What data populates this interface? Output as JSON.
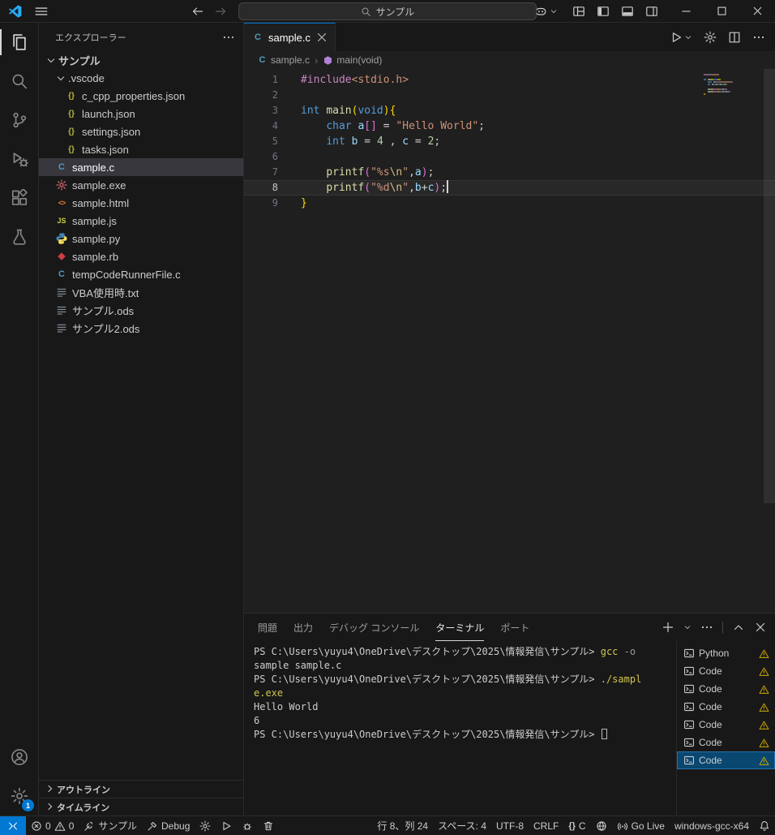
{
  "titlebar": {
    "command_center_text": "サンプル",
    "left_icons": [
      {
        "icon": "vscode-logo",
        "name": "vscode-logo",
        "clickable": false
      },
      {
        "icon": "menu",
        "name": "menu-button",
        "clickable": true
      }
    ],
    "nav": [
      {
        "icon": "arrow-left",
        "name": "back-button",
        "enabled": true
      },
      {
        "icon": "arrow-right",
        "name": "forward-button",
        "enabled": false
      }
    ],
    "right_controls": [
      {
        "icon": "copilot",
        "name": "copilot-menu",
        "chevron": true
      },
      {
        "icon": "layout-grid",
        "name": "customize-layout-button"
      },
      {
        "icon": "layout-sidebar-left",
        "name": "toggle-primary-sidebar-button"
      },
      {
        "icon": "layout-panel",
        "name": "toggle-panel-button"
      },
      {
        "icon": "layout-sidebar-right",
        "name": "toggle-secondary-sidebar-button"
      }
    ],
    "window_controls": [
      {
        "icon": "minimize",
        "name": "minimize-button"
      },
      {
        "icon": "maximize",
        "name": "maximize-button"
      },
      {
        "icon": "close",
        "name": "close-button"
      }
    ]
  },
  "activity_bar": {
    "items": [
      {
        "icon": "files",
        "name": "explorer",
        "active": true
      },
      {
        "icon": "search",
        "name": "search"
      },
      {
        "icon": "source-control",
        "name": "source-control"
      },
      {
        "icon": "debug",
        "name": "run-and-debug"
      },
      {
        "icon": "extensions",
        "name": "extensions"
      },
      {
        "icon": "beaker",
        "name": "testing"
      }
    ],
    "bottom": [
      {
        "icon": "account",
        "name": "accounts"
      },
      {
        "icon": "gear",
        "name": "manage",
        "badge": "1"
      }
    ]
  },
  "explorer": {
    "title": "エクスプローラー",
    "tree": [
      {
        "label": "サンプル",
        "level": 0,
        "chevron": "down",
        "bold": true
      },
      {
        "label": ".vscode",
        "level": 1,
        "chevron": "down"
      },
      {
        "label": "c_cpp_properties.json",
        "icon": "json",
        "level": 2
      },
      {
        "label": "launch.json",
        "icon": "json",
        "level": 2
      },
      {
        "label": "settings.json",
        "icon": "json",
        "level": 2
      },
      {
        "label": "tasks.json",
        "icon": "json",
        "level": 2
      },
      {
        "label": "sample.c",
        "icon": "c-file",
        "level": 1,
        "selected": true
      },
      {
        "label": "sample.exe",
        "icon": "exe-file",
        "level": 1
      },
      {
        "label": "sample.html",
        "icon": "html-file",
        "level": 1
      },
      {
        "label": "sample.js",
        "icon": "js-file",
        "level": 1
      },
      {
        "label": "sample.py",
        "icon": "py-file",
        "level": 1
      },
      {
        "label": "sample.rb",
        "icon": "rb-file",
        "level": 1
      },
      {
        "label": "tempCodeRunnerFile.c",
        "icon": "c-file",
        "level": 1
      },
      {
        "label": "VBA使用時.txt",
        "icon": "txt-file",
        "level": 1
      },
      {
        "label": "サンプル.ods",
        "icon": "txt-file",
        "level": 1
      },
      {
        "label": "サンプル2.ods",
        "icon": "txt-file",
        "level": 1
      }
    ],
    "sections": [
      {
        "label": "アウトライン"
      },
      {
        "label": "タイムライン"
      }
    ]
  },
  "editor": {
    "tab": {
      "label": "sample.c",
      "icon": "c-file"
    },
    "actions": [
      {
        "icon": "play",
        "name": "run-code-button",
        "chevron": true
      },
      {
        "icon": "gear",
        "name": "run-settings-button"
      },
      {
        "icon": "split",
        "name": "split-editor-button"
      },
      {
        "icon": "ellipsis",
        "name": "more-actions-button"
      }
    ],
    "breadcrumb": [
      {
        "label": "sample.c",
        "icon": "c-file"
      },
      {
        "label": "main(void)",
        "icon": "symbol-method"
      }
    ],
    "cursor_position": {
      "line": 8,
      "column": 24
    },
    "code_lines": [
      {
        "num": 1,
        "tokens": [
          {
            "t": "#include",
            "c": "pp"
          },
          {
            "t": "<stdio.h>",
            "c": "str"
          }
        ]
      },
      {
        "num": 2,
        "tokens": []
      },
      {
        "num": 3,
        "tokens": [
          {
            "t": "int",
            "c": "kw"
          },
          {
            "t": " ",
            "c": "fg"
          },
          {
            "t": "main",
            "c": "fn"
          },
          {
            "t": "(",
            "c": "b1"
          },
          {
            "t": "void",
            "c": "kw"
          },
          {
            "t": ")",
            "c": "b1"
          },
          {
            "t": "{",
            "c": "b1"
          }
        ]
      },
      {
        "num": 4,
        "tokens": [
          {
            "t": "    ",
            "c": "fg"
          },
          {
            "t": "char",
            "c": "kw"
          },
          {
            "t": " ",
            "c": "fg"
          },
          {
            "t": "a",
            "c": "var"
          },
          {
            "t": "[]",
            "c": "b2"
          },
          {
            "t": " = ",
            "c": "fg"
          },
          {
            "t": "\"Hello World\"",
            "c": "str"
          },
          {
            "t": ";",
            "c": "fg"
          }
        ]
      },
      {
        "num": 5,
        "tokens": [
          {
            "t": "    ",
            "c": "fg"
          },
          {
            "t": "int",
            "c": "kw"
          },
          {
            "t": " ",
            "c": "fg"
          },
          {
            "t": "b",
            "c": "var"
          },
          {
            "t": " = ",
            "c": "fg"
          },
          {
            "t": "4",
            "c": "num"
          },
          {
            "t": " , ",
            "c": "fg"
          },
          {
            "t": "c",
            "c": "var"
          },
          {
            "t": " = ",
            "c": "fg"
          },
          {
            "t": "2",
            "c": "num"
          },
          {
            "t": ";",
            "c": "fg"
          }
        ]
      },
      {
        "num": 6,
        "tokens": []
      },
      {
        "num": 7,
        "tokens": [
          {
            "t": "    ",
            "c": "fg"
          },
          {
            "t": "printf",
            "c": "fn"
          },
          {
            "t": "(",
            "c": "b2"
          },
          {
            "t": "\"%s",
            "c": "str"
          },
          {
            "t": "\\n",
            "c": "esc"
          },
          {
            "t": "\"",
            "c": "str"
          },
          {
            "t": ",",
            "c": "fg"
          },
          {
            "t": "a",
            "c": "var"
          },
          {
            "t": ")",
            "c": "b2"
          },
          {
            "t": ";",
            "c": "fg"
          }
        ]
      },
      {
        "num": 8,
        "current": true,
        "cursor": true,
        "tokens": [
          {
            "t": "    ",
            "c": "fg"
          },
          {
            "t": "printf",
            "c": "fn"
          },
          {
            "t": "(",
            "c": "b2"
          },
          {
            "t": "\"%d",
            "c": "str"
          },
          {
            "t": "\\n",
            "c": "esc"
          },
          {
            "t": "\"",
            "c": "str"
          },
          {
            "t": ",",
            "c": "fg"
          },
          {
            "t": "b",
            "c": "var"
          },
          {
            "t": "+",
            "c": "fg"
          },
          {
            "t": "c",
            "c": "var"
          },
          {
            "t": ")",
            "c": "b2"
          },
          {
            "t": ";",
            "c": "fg"
          }
        ]
      },
      {
        "num": 9,
        "tokens": [
          {
            "t": "}",
            "c": "b1"
          }
        ]
      }
    ]
  },
  "panel": {
    "tabs": [
      {
        "label": "問題"
      },
      {
        "label": "出力"
      },
      {
        "label": "デバッグ コンソール"
      },
      {
        "label": "ターミナル",
        "active": true
      },
      {
        "label": "ポート"
      }
    ],
    "actions": [
      {
        "icon": "plus",
        "name": "new-terminal-button"
      },
      {
        "icon": "chevron-down",
        "name": "terminal-profile-button"
      },
      {
        "icon": "ellipsis",
        "name": "panel-more-button"
      },
      {
        "divider": true
      },
      {
        "icon": "chevron-up",
        "name": "maximize-panel-button"
      },
      {
        "icon": "close",
        "name": "close-panel-button"
      }
    ],
    "terminal_lines": [
      {
        "tokens": [
          {
            "t": "PS C:\\Users\\yuyu4\\OneDrive\\デスクトップ\\2025\\情報発信\\サンプル> ",
            "c": "fg"
          },
          {
            "t": "gcc",
            "c": "cmd"
          },
          {
            "t": " ",
            "c": "fg"
          },
          {
            "t": "-o",
            "c": "param"
          }
        ]
      },
      {
        "tokens": [
          {
            "t": "sample sample.c",
            "c": "fg"
          }
        ]
      },
      {
        "tokens": [
          {
            "t": "PS C:\\Users\\yuyu4\\OneDrive\\デスクトップ\\2025\\情報発信\\サンプル> ",
            "c": "fg"
          },
          {
            "t": "./sampl",
            "c": "cmd"
          }
        ]
      },
      {
        "tokens": [
          {
            "t": "e.exe",
            "c": "cmd"
          }
        ]
      },
      {
        "tokens": [
          {
            "t": "Hello World",
            "c": "fg"
          }
        ]
      },
      {
        "tokens": [
          {
            "t": "6",
            "c": "fg"
          }
        ]
      },
      {
        "tokens": [
          {
            "t": "PS C:\\Users\\yuyu4\\OneDrive\\デスクトップ\\2025\\情報発信\\サンプル> ",
            "c": "fg"
          },
          {
            "t": "▯",
            "c": "cursor"
          }
        ]
      }
    ],
    "terminals": [
      {
        "label": "Python",
        "icon": "terminal",
        "warning": true
      },
      {
        "label": "Code",
        "icon": "terminal",
        "warning": true
      },
      {
        "label": "Code",
        "icon": "terminal",
        "warning": true
      },
      {
        "label": "Code",
        "icon": "terminal",
        "warning": true
      },
      {
        "label": "Code",
        "icon": "terminal",
        "warning": true
      },
      {
        "label": "Code",
        "icon": "terminal",
        "warning": true
      },
      {
        "label": "Code",
        "icon": "terminal",
        "warning": true,
        "selected": true
      }
    ]
  },
  "status_bar": {
    "left": [
      {
        "name": "remote-indicator",
        "accent": true,
        "parts": [
          {
            "icon": "remote"
          }
        ]
      },
      {
        "name": "problems",
        "parts": [
          {
            "icon": "error"
          },
          {
            "text": "0"
          },
          {
            "icon": "warning-plain"
          },
          {
            "text": "0"
          }
        ]
      },
      {
        "name": "project",
        "parts": [
          {
            "icon": "wrench"
          },
          {
            "text": "サンプル"
          }
        ]
      },
      {
        "name": "build-variant",
        "parts": [
          {
            "icon": "hammer"
          },
          {
            "text": "Debug"
          }
        ]
      },
      {
        "name": "build-settings",
        "parts": [
          {
            "icon": "gear"
          }
        ]
      },
      {
        "name": "run-project",
        "parts": [
          {
            "icon": "play"
          }
        ]
      },
      {
        "name": "debug-project",
        "parts": [
          {
            "icon": "bug"
          }
        ]
      },
      {
        "name": "clean-build",
        "parts": [
          {
            "icon": "trash"
          }
        ]
      }
    ],
    "right": [
      {
        "name": "cursor-position",
        "parts": [
          {
            "text": "行 8、列 24"
          }
        ]
      },
      {
        "name": "indentation",
        "parts": [
          {
            "text": "スペース: 4"
          }
        ]
      },
      {
        "name": "encoding",
        "parts": [
          {
            "text": "UTF-8"
          }
        ]
      },
      {
        "name": "eol-sequence",
        "parts": [
          {
            "text": "CRLF"
          }
        ]
      },
      {
        "name": "language-mode",
        "parts": [
          {
            "braces": "{}"
          },
          {
            "text": "C"
          }
        ]
      },
      {
        "name": "browser-preview",
        "parts": [
          {
            "icon": "globe"
          }
        ]
      },
      {
        "name": "go-live",
        "parts": [
          {
            "icon": "broadcast"
          },
          {
            "text": "Go Live"
          }
        ]
      },
      {
        "name": "compiler-config",
        "parts": [
          {
            "text": "windows-gcc-x64"
          }
        ]
      },
      {
        "name": "notifications",
        "parts": [
          {
            "icon": "bell"
          }
        ]
      }
    ]
  }
}
